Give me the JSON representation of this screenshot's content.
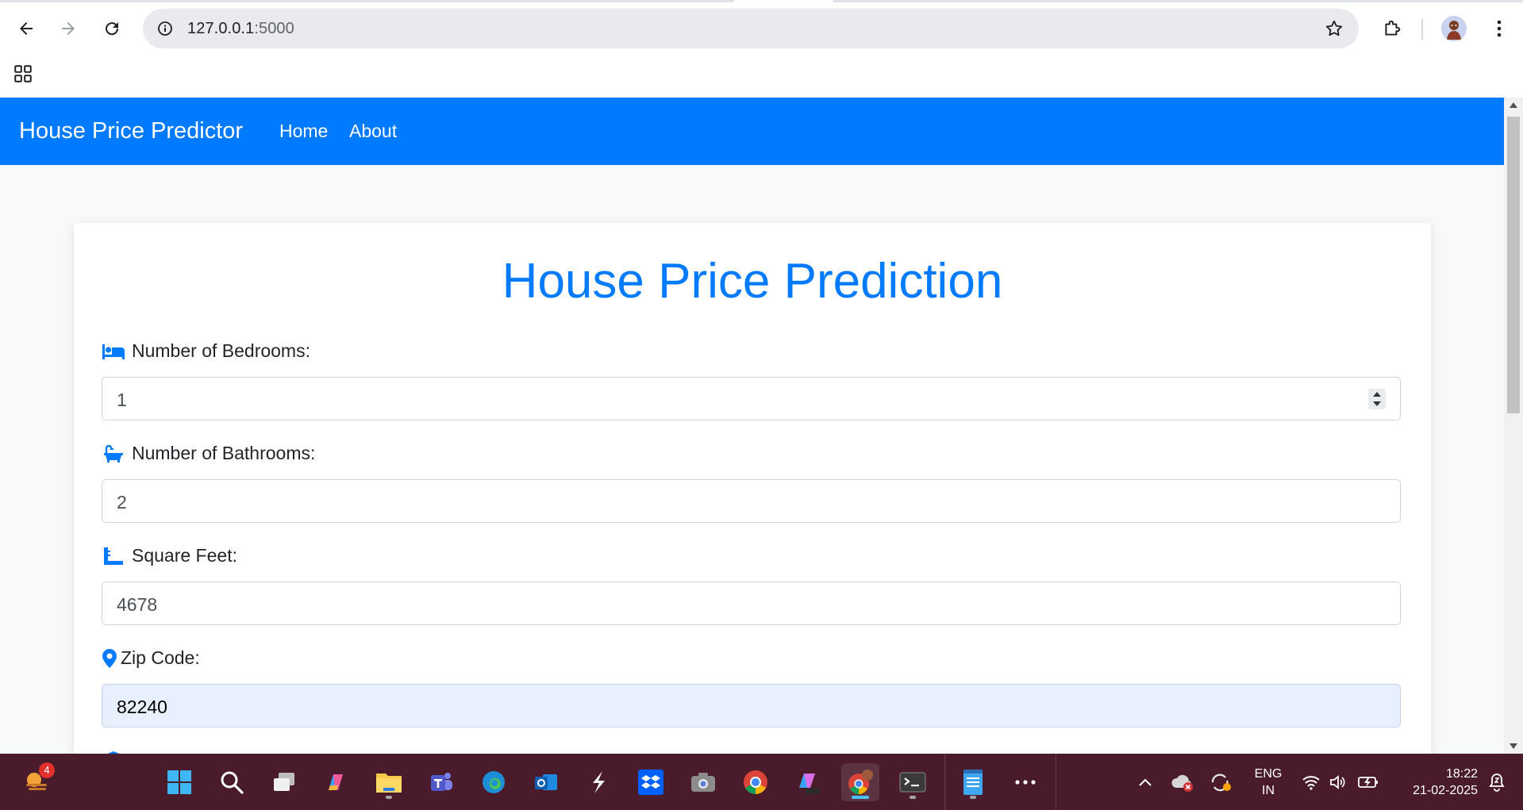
{
  "browser": {
    "url_host": "127.0.0.1",
    "url_port": ":5000"
  },
  "navbar": {
    "brand": "House Price Predictor",
    "links": [
      "Home",
      "About"
    ]
  },
  "form": {
    "title": "House Price Prediction",
    "fields": [
      {
        "label": "Number of Bedrooms:",
        "value": "1",
        "icon": "bed-icon"
      },
      {
        "label": "Number of Bathrooms:",
        "value": "2",
        "icon": "bath-icon"
      },
      {
        "label": "Square Feet:",
        "value": "4678",
        "icon": "ruler-icon"
      },
      {
        "label": "Zip Code:",
        "value": "82240",
        "icon": "map-marker-icon"
      }
    ]
  },
  "taskbar": {
    "weather_badge": "4",
    "language": [
      "ENG",
      "IN"
    ],
    "time": "18:22",
    "date": "21-02-2025"
  },
  "colors": {
    "primary": "#007bff",
    "taskbar": "#4a1c2b",
    "autofill": "#e8f0fe"
  }
}
